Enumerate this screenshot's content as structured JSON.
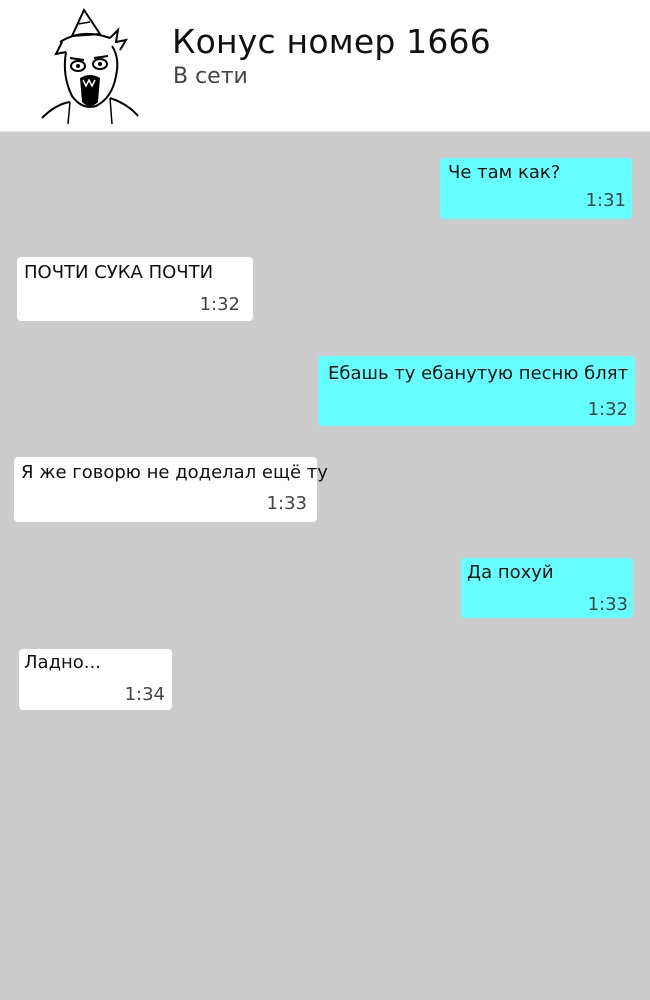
{
  "header": {
    "contact_name": "Конус номер 1666",
    "status": "В сети",
    "avatar_icon": "cone-meme-face-icon"
  },
  "colors": {
    "outgoing_bubble": "#66ffff",
    "incoming_bubble": "#ffffff",
    "chat_background": "#cccccc",
    "header_background": "#ffffff"
  },
  "messages": [
    {
      "direction": "outgoing",
      "text": "Че там как?",
      "time": "1:31"
    },
    {
      "direction": "incoming",
      "text": "ПОЧТИ СУКА ПОЧТИ",
      "time": "1:32"
    },
    {
      "direction": "outgoing",
      "text": "Ебашь ту ебанутую песню блят",
      "time": "1:32"
    },
    {
      "direction": "incoming",
      "text": "Я же говорю не доделал ещё ту",
      "time": "1:33"
    },
    {
      "direction": "outgoing",
      "text": "Да похуй",
      "time": "1:33"
    },
    {
      "direction": "incoming",
      "text": "Ладно...",
      "time": "1:34"
    }
  ]
}
